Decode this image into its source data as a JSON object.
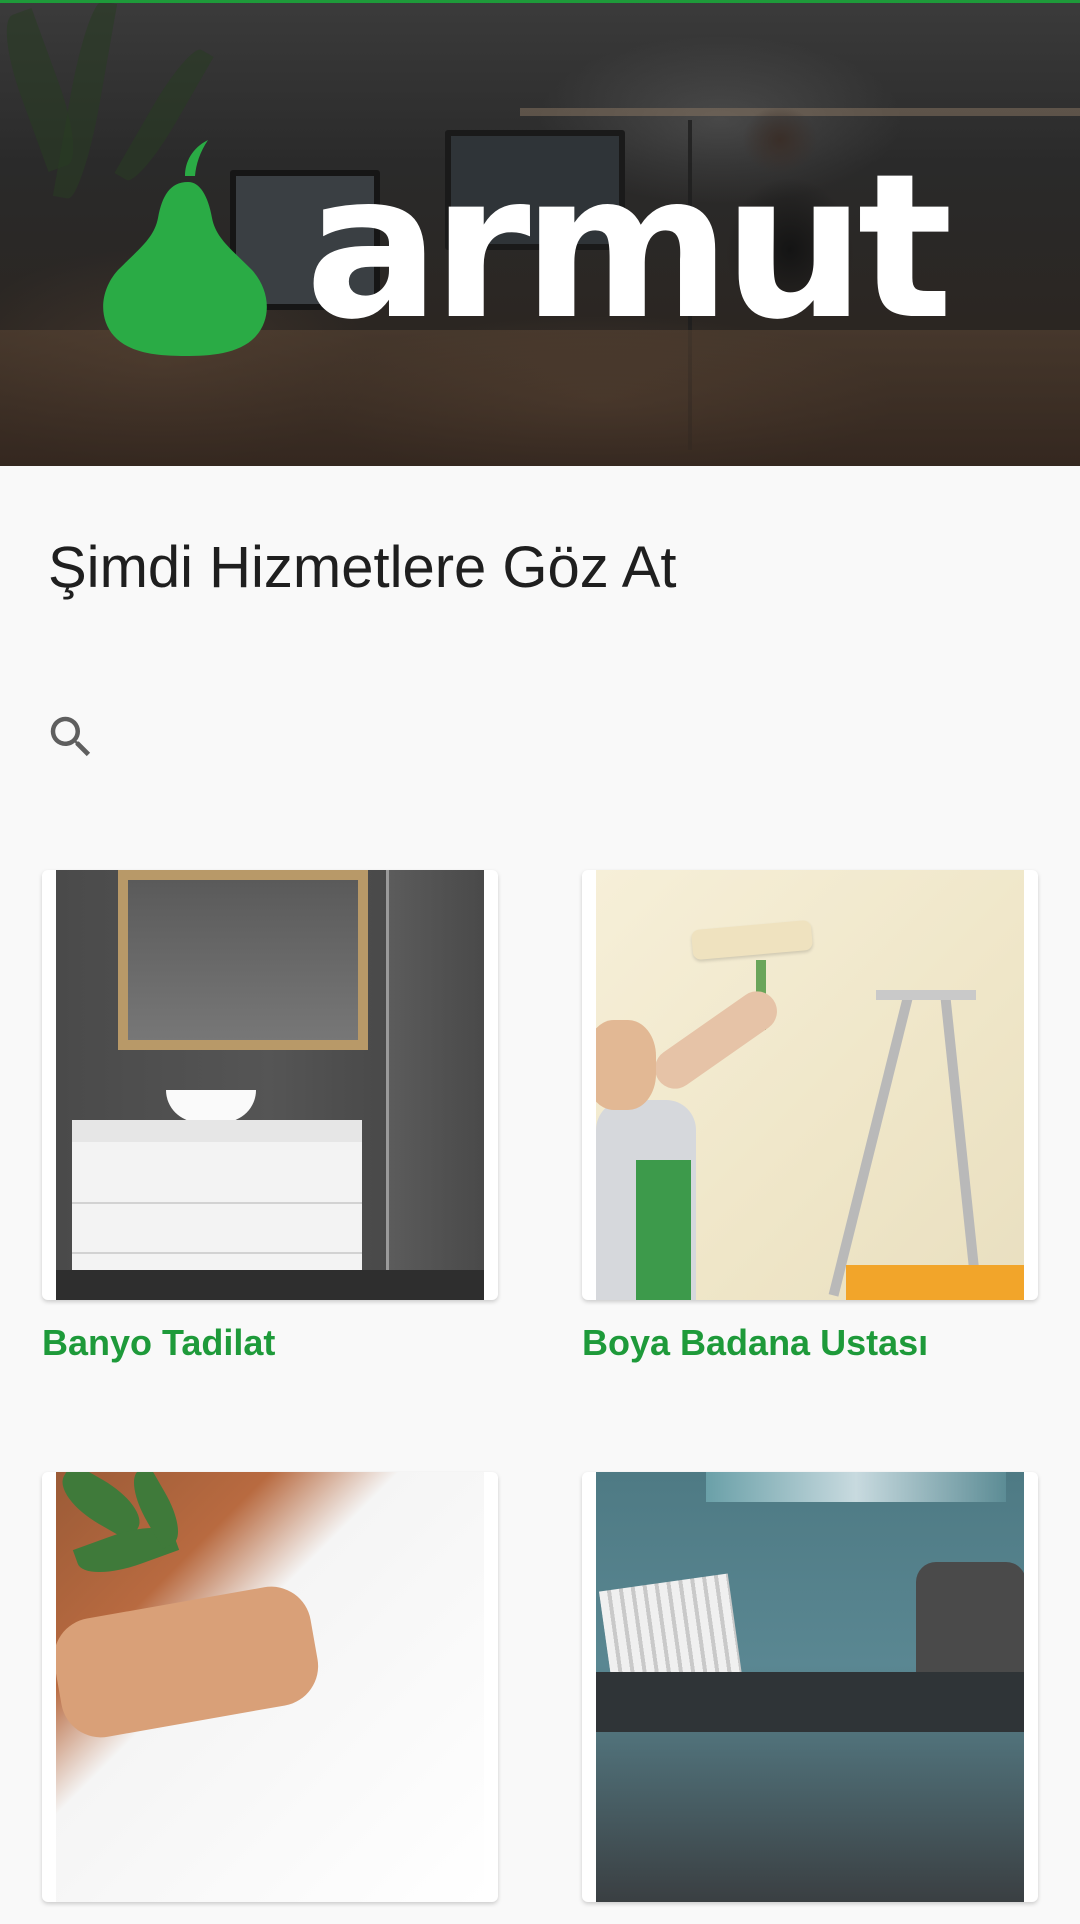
{
  "brand": {
    "name": "armut",
    "accent_color": "#1e9a3a",
    "logo_icon": "pear-icon"
  },
  "page": {
    "title": "Şimdi Hizmetlere Göz At"
  },
  "search": {
    "icon": "search-icon",
    "value": "",
    "placeholder": ""
  },
  "services": [
    {
      "label": "Banyo Tadilat",
      "image": "bathroom-photo"
    },
    {
      "label": "Boya Badana Ustası",
      "image": "painter-photo"
    },
    {
      "label": "",
      "image": "massage-photo"
    },
    {
      "label": "",
      "image": "sofa-photo"
    }
  ]
}
